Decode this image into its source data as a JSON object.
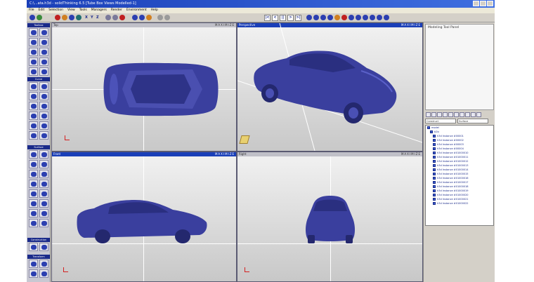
{
  "window": {
    "title": "C:\\...ata.h3d - solidThinking 6.5  [Tube Box Views Modelled-1]"
  },
  "menu": [
    "File",
    "Edit",
    "Selection",
    "View",
    "Tools",
    "Managers",
    "Render",
    "Environment",
    "Help"
  ],
  "toolbar": {
    "axis_labels": [
      "X",
      "Y",
      "Z"
    ],
    "play_controls": [
      "|<",
      "<",
      "||",
      ">",
      ">|"
    ]
  },
  "toolbox": {
    "sections": [
      "Toolbox",
      "Curve",
      "Surface",
      "Construction Plane",
      "Transform"
    ]
  },
  "viewports": [
    {
      "label": "Top",
      "controls": "MAXIMIZE",
      "active": false
    },
    {
      "label": "Perspective",
      "controls": "MAXIMIZE",
      "active": true
    },
    {
      "label": "Front",
      "controls": "MAXIMIZE",
      "active": true
    },
    {
      "label": "Right",
      "controls": "MAXIMIZE",
      "active": false
    }
  ],
  "right_panel": {
    "title": "Modeling Tool Panel",
    "select_left": "Construct",
    "select_right": "Surface",
    "tree": [
      "model",
      "b2b",
      "h3d Instance #00001",
      "h3d Instance #00002",
      "h3d Instance #00003",
      "h3d Instance #00004",
      "h3d Instance #01000010",
      "h3d Instance #01000011",
      "h3d Instance #01000012",
      "h3d Instance #01000013",
      "h3d Instance #01000014",
      "h3d Instance #01000015",
      "h3d Instance #01000016",
      "h3d Instance #01000017",
      "h3d Instance #01000018",
      "h3d Instance #01000019",
      "h3d Instance #01000020",
      "h3d Instance #01000021",
      "h3d Instance #01000022"
    ]
  },
  "colors": {
    "car": "#3a3f9e",
    "title_bar": "#1a3fb8",
    "viewport_bg": "#e6e6e6"
  }
}
